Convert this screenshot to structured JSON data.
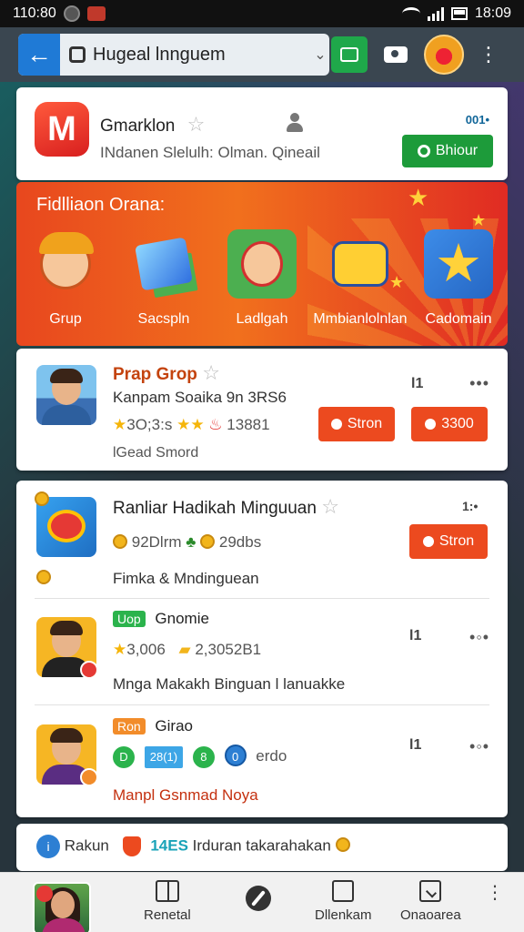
{
  "status_bar": {
    "time_left": "110:80",
    "time_right": "18:09"
  },
  "toolbar": {
    "url_text": "Hugeal lnnguem",
    "url_more": "⌄"
  },
  "app_card": {
    "logo_letter": "M",
    "name": "Gmarklon",
    "subtitle": "INdanen Slelulh: Olman. Qineail",
    "count": "001•",
    "follow_label": "Bhiour"
  },
  "banner": {
    "title": "Fidlliaon Orana:",
    "items": [
      {
        "label": "Grup"
      },
      {
        "label": "Sacspln"
      },
      {
        "label": "Ladlgah"
      },
      {
        "label": "Mmbianlolnlan"
      },
      {
        "label": "Cadomain"
      }
    ]
  },
  "card_a": {
    "title": "Prap Grop",
    "line": "Kanpam Soaika 9n 3RS6",
    "rating": "3O;3:s",
    "meta_value": "13881",
    "footer": "lGead Smord",
    "side_count": "l1",
    "btn1": "Stron",
    "btn2": "3300"
  },
  "card_b": {
    "title": "Ranliar Hadikah Minguuan",
    "side_count": "1:•",
    "coins": "92Dlrm",
    "dbs": "29dbs",
    "desc": "Fimka & Mndinguean",
    "btn": "Stron",
    "item2": {
      "tag": "Uop",
      "title": "Gnomie",
      "rating": "3,006",
      "meta": "2,3052B1",
      "desc": "Mnga Makakh Binguan l lanuakke",
      "side_count": "l1"
    },
    "item3": {
      "tag": "Ron",
      "title": "Girao",
      "pill1": "D",
      "pill2": "28(1)",
      "pill3": "8",
      "pill4": "0",
      "meta": "erdo",
      "desc": "Manpl Gsnmad Noya",
      "side_count": "l1"
    }
  },
  "card_c": {
    "label": "Rakun",
    "highlight": "14ES",
    "text": "Irduran takarahakan"
  },
  "bottom_nav": {
    "items": [
      {
        "label": "Renetal"
      },
      {
        "label": ""
      },
      {
        "label": "Dllenkam"
      },
      {
        "label": "Onaoarea"
      }
    ]
  }
}
